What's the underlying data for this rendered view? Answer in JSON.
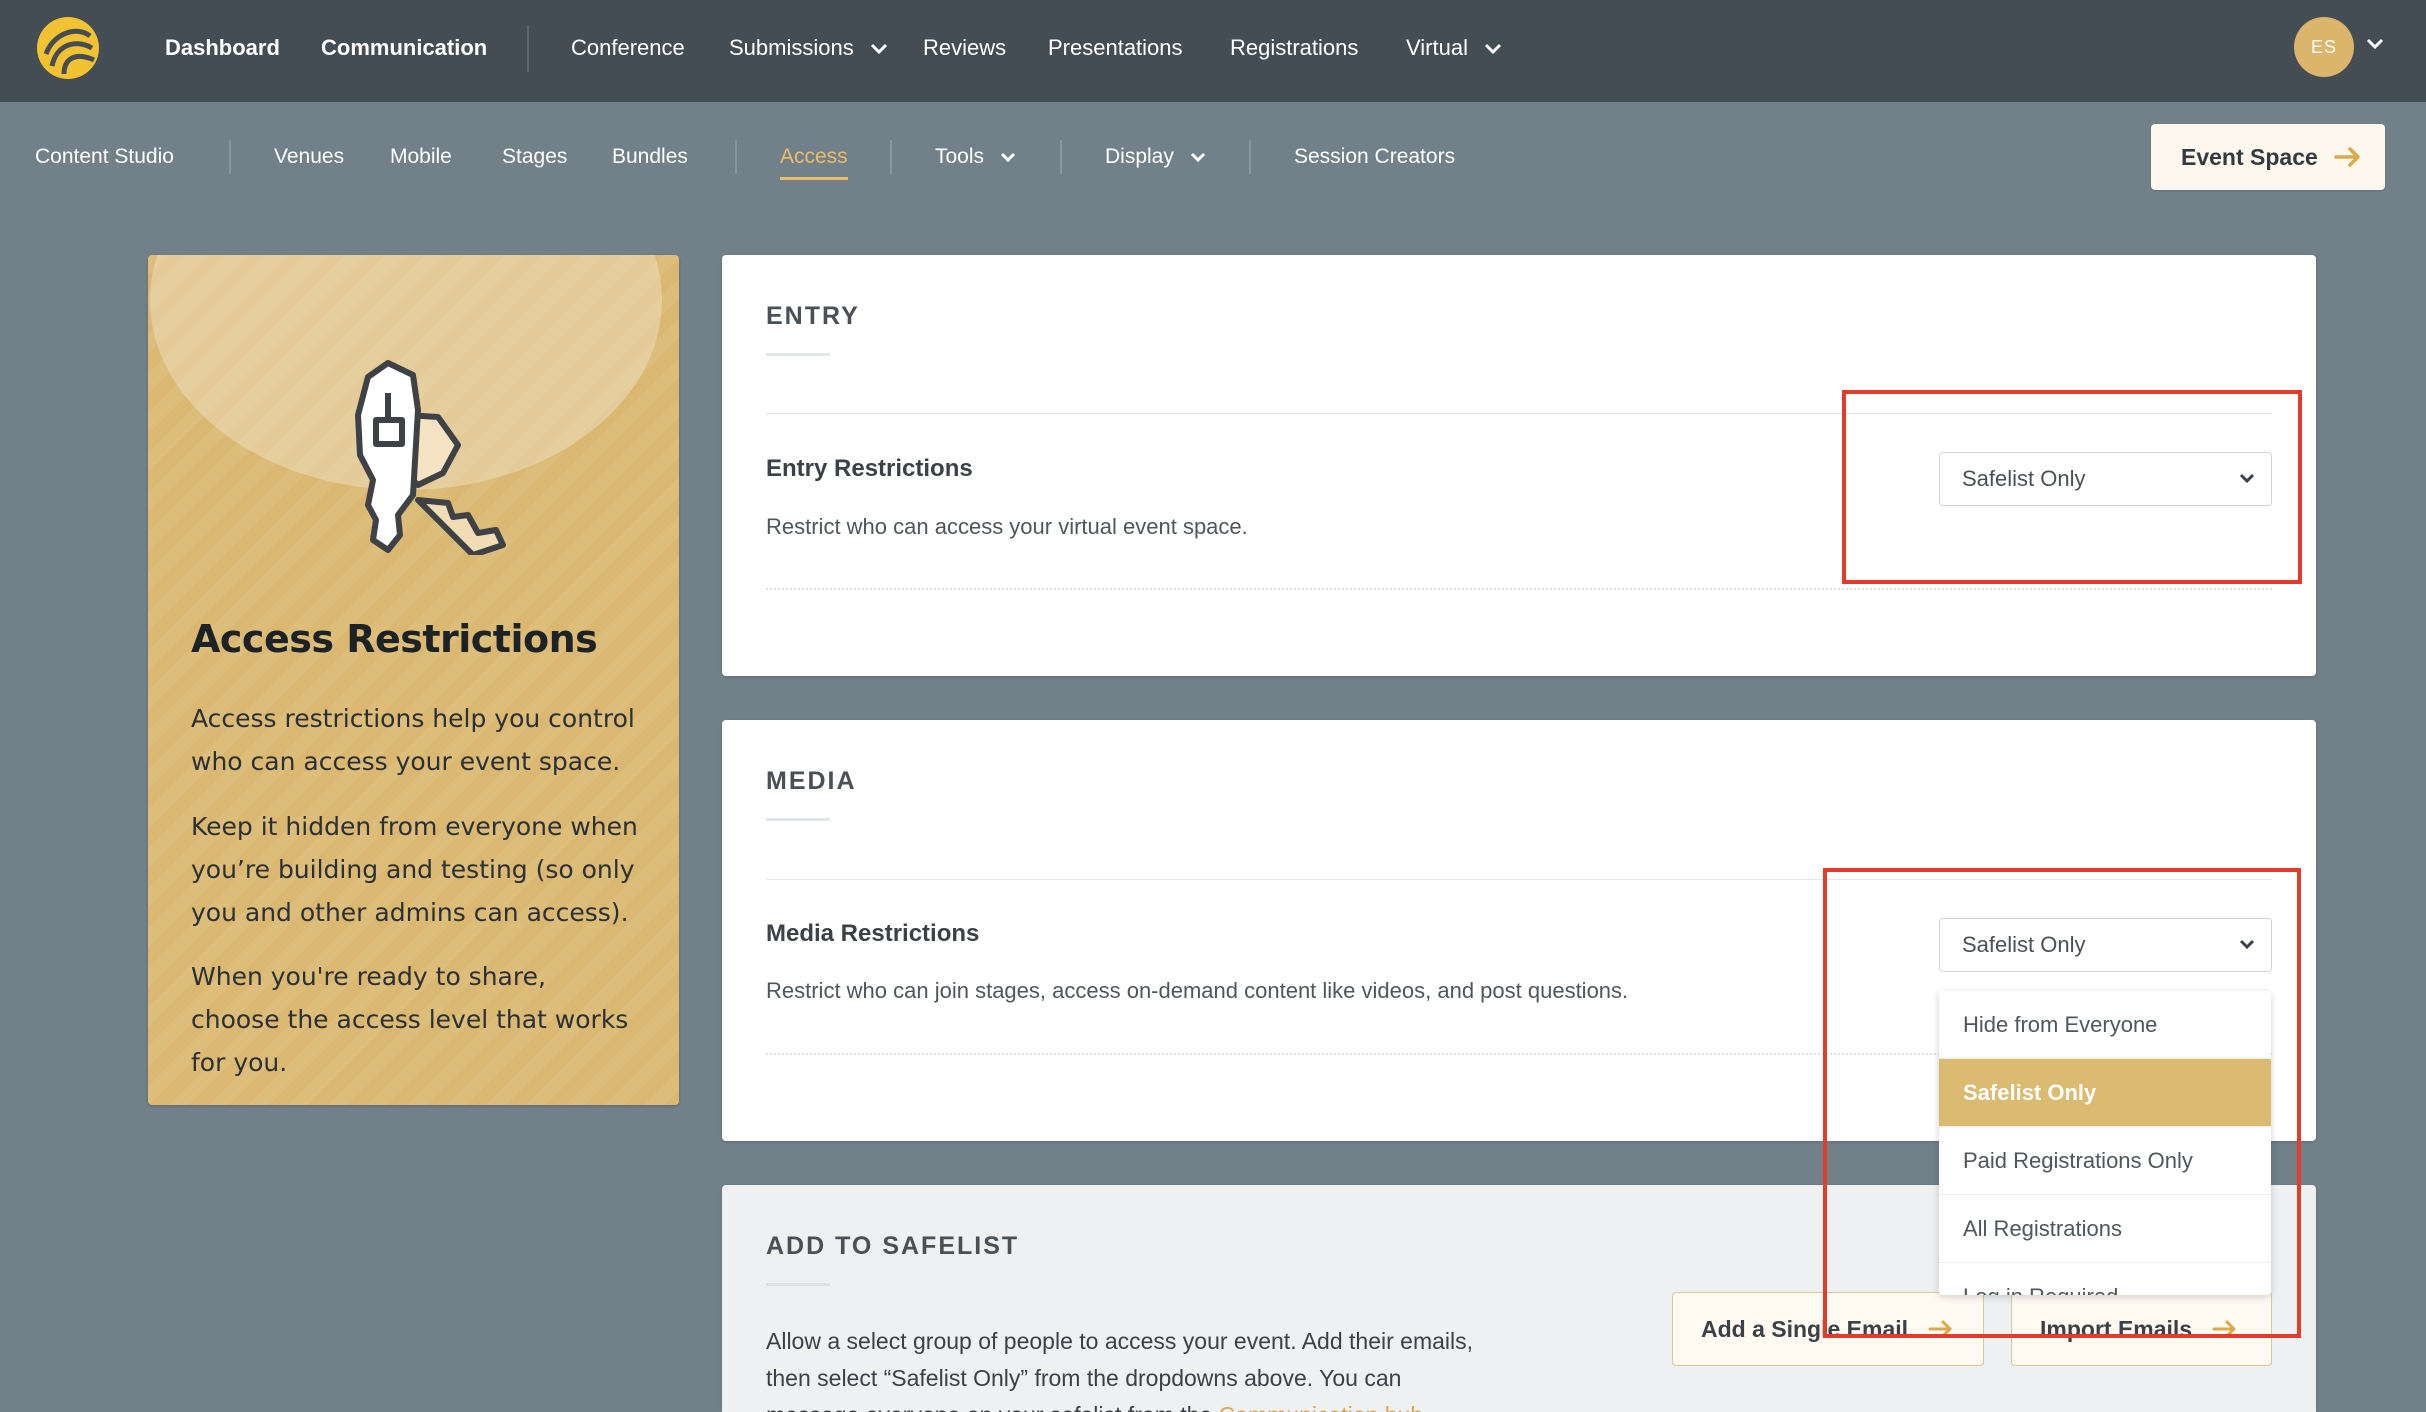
{
  "topnav": {
    "items": [
      "Dashboard",
      "Communication",
      "Conference",
      "Submissions",
      "Reviews",
      "Presentations",
      "Registrations",
      "Virtual"
    ],
    "avatar_initials": "ES"
  },
  "subnav": {
    "items": [
      "Content Studio",
      "Venues",
      "Mobile",
      "Stages",
      "Bundles",
      "Access",
      "Tools",
      "Display",
      "Session Creators"
    ],
    "active": "Access",
    "event_space_label": "Event Space"
  },
  "info_card": {
    "title": "Access Restrictions",
    "paragraphs": [
      "Access restrictions help you control who can access your event space.",
      "Keep it hidden from everyone when you’re building and testing (so only you and other admins can access).",
      "When you're ready to share, choose the access level that works for you."
    ],
    "icon": "keys-icon"
  },
  "entry": {
    "section_title": "ENTRY",
    "label": "Entry Restrictions",
    "description": "Restrict who can access your virtual event space.",
    "selected": "Safelist Only"
  },
  "media": {
    "section_title": "MEDIA",
    "label": "Media Restrictions",
    "description": "Restrict who can join stages, access on-demand content like videos, and post questions.",
    "selected": "Safelist Only",
    "options": [
      "Hide from Everyone",
      "Safelist Only",
      "Paid Registrations Only",
      "All Registrations",
      "Log in Required"
    ]
  },
  "safelist": {
    "section_title": "ADD TO SAFELIST",
    "text_line1": "Allow a select group of people to access your event. Add their emails,",
    "text_line2": "then select “Safelist Only” from the dropdowns above. You can",
    "text_line3": "message everyone on your safelist from the",
    "link_text": "Communication hub",
    "add_single_label": "Add a Single Email",
    "import_label": "Import Emails"
  },
  "colors": {
    "topbar": "#444c54",
    "background": "#728089",
    "accent": "#dbba72",
    "highlight": "#e23c2d"
  }
}
